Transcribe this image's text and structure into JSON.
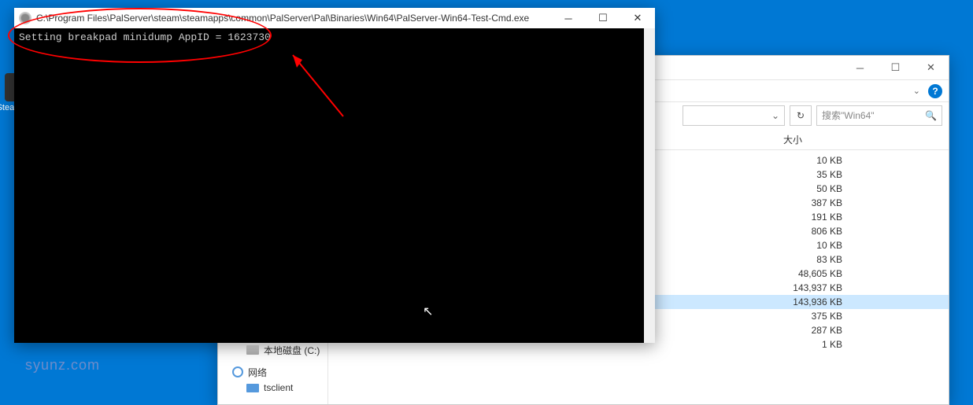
{
  "desktop": {
    "icons": [
      {
        "label": "SteamCMD"
      }
    ]
  },
  "console": {
    "title": "C:\\Program Files\\PalServer\\steam\\steamapps\\common\\PalServer\\Pal\\Binaries\\Win64\\PalServer-Win64-Test-Cmd.exe",
    "line1": "Setting breakpad minidump AppID = 1623730"
  },
  "explorer": {
    "size_header": "大小",
    "search_placeholder": "搜索\"Win64\"",
    "sidebar": {
      "drive": "本地磁盘 (C:)",
      "network": "网络",
      "tsclient": "tsclient"
    },
    "files": [
      {
        "size": "10 KB"
      },
      {
        "size": "35 KB"
      },
      {
        "size": "50 KB"
      },
      {
        "size": "387 KB"
      },
      {
        "size": "191 KB"
      },
      {
        "size": "806 KB"
      },
      {
        "size": "10 KB"
      },
      {
        "size": "83 KB"
      },
      {
        "size": "48,605 KB"
      },
      {
        "size": "143,937 KB"
      },
      {
        "size": "143,936 KB",
        "selected": true
      },
      {
        "size": "375 KB"
      },
      {
        "size": "287 KB"
      },
      {
        "size": "1 KB"
      }
    ]
  },
  "watermark": "syunz.com"
}
